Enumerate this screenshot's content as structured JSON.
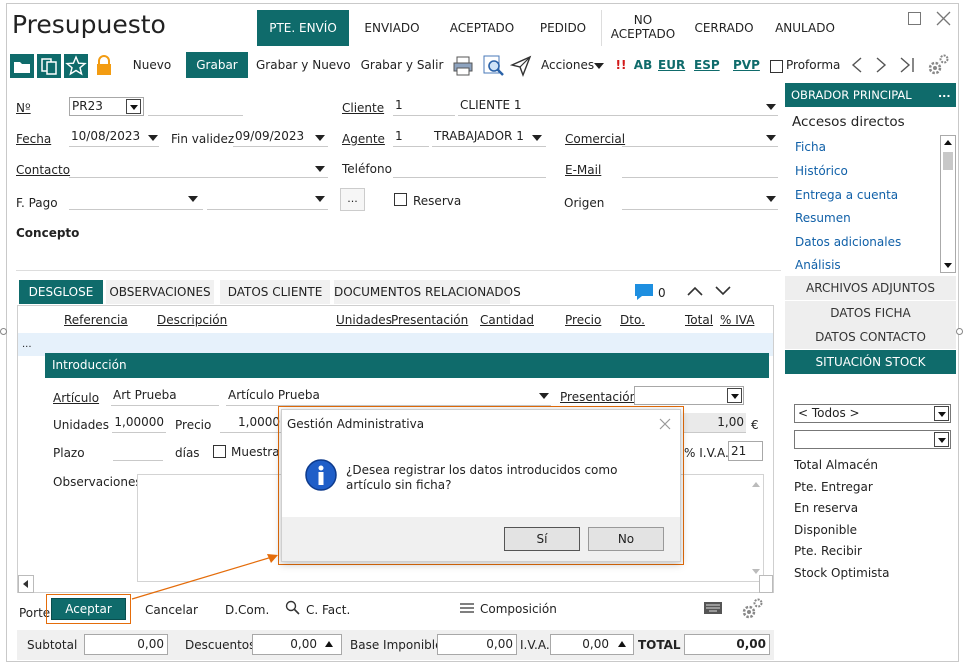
{
  "window": {
    "title": "Presupuesto"
  },
  "status_tabs": [
    "PTE. ENVÍO",
    "ENVIADO",
    "ACEPTADO",
    "PEDIDO",
    "NO\nACEPTADO",
    "CERRADO",
    "ANULADO"
  ],
  "toolbar": {
    "nuevo": "Nuevo",
    "grabar": "Grabar",
    "grabar_nuevo": "Grabar y Nuevo",
    "grabar_salir": "Grabar y Salir",
    "acciones": "Acciones",
    "excl": "!!",
    "ab": "AB",
    "eur": "EUR",
    "esp": "ESP",
    "pvp": "PVP",
    "proforma": "Proforma"
  },
  "form": {
    "n_label": "Nº",
    "n_value": "PR23",
    "cliente_label": "Cliente",
    "cliente_code": "1",
    "cliente_name": "CLIENTE 1",
    "fecha_label": "Fecha",
    "fecha_value": "10/08/2023",
    "fin_validez_label": "Fin validez",
    "fin_validez_value": "09/09/2023",
    "agente_label": "Agente",
    "agente_code": "1",
    "agente_name": "TRABAJADOR 1",
    "comercial_label": "Comercial",
    "contacto_label": "Contacto",
    "telefono_label": "Teléfono",
    "email_label": "E-Mail",
    "fpago_label": "F. Pago",
    "dots": "...",
    "reserva_label": "Reserva",
    "origen_label": "Origen",
    "concepto_label": "Concepto"
  },
  "tabs": [
    "DESGLOSE",
    "OBSERVACIONES",
    "DATOS CLIENTE",
    "DOCUMENTOS RELACIONADOS"
  ],
  "comments_count": "0",
  "table": {
    "headers": [
      "Referencia",
      "Descripción",
      "Unidades",
      "Presentación",
      "Cantidad",
      "Precio",
      "Dto.",
      "Total",
      "% IVA"
    ],
    "row_marker": "..."
  },
  "intro": {
    "title": "Introducción",
    "articulo_label": "Artículo",
    "articulo_code": "Art Prueba",
    "articulo_name": "Artículo Prueba",
    "presentacion_label": "Presentación",
    "unidades_label": "Unidades",
    "unidades_value": "1,00000",
    "precio_label": "Precio",
    "precio_value": "1,0000",
    "total_value": "1,00",
    "currency": "€",
    "plazo_label": "Plazo",
    "dias_label": "días",
    "muestra_label": "Muestra",
    "iva_label": "% I.V.A.",
    "iva_value": "21",
    "observaciones_label": "Observaciones",
    "aceptar": "Aceptar",
    "cancelar": "Cancelar",
    "dcom": "D.Com.",
    "cfact": "C. Fact.",
    "composicion": "Composición",
    "porte_label": "Porte"
  },
  "dialog": {
    "title": "Gestión Administrativa",
    "message": "¿Desea registrar los datos introducidos como artículo sin ficha?",
    "yes": "Sí",
    "no": "No"
  },
  "totals": {
    "subtotal_label": "Subtotal",
    "subtotal": "0,00",
    "descuentos_label": "Descuentos",
    "descuentos": "0,00",
    "base_label": "Base Imponible",
    "base": "0,00",
    "iva_label": "I.V.A.",
    "iva": "0,00",
    "total_label": "TOTAL",
    "total": "0,00"
  },
  "right_panel": {
    "header": "OBRADOR PRINCIPAL",
    "header_dots": "...",
    "accesos": "Accesos directos",
    "links": [
      "Ficha",
      "Histórico",
      "Entrega a cuenta",
      "Resumen",
      "Datos adicionales",
      "Análisis"
    ],
    "archivos": "ARCHIVOS ADJUNTOS",
    "datos_ficha": "DATOS FICHA",
    "datos_contacto": "DATOS CONTACTO",
    "situacion_stock": "SITUACIÓN STOCK",
    "almacen_select": "< Todos >",
    "stock_rows": [
      "Total Almacén",
      "Pte. Entregar",
      "En reserva",
      "Disponible",
      "Pte. Recibir",
      "Stock Optimista"
    ]
  },
  "colors": {
    "accent": "#0f6b6b",
    "link": "#1060a8",
    "highlight": "#e46c0a"
  }
}
